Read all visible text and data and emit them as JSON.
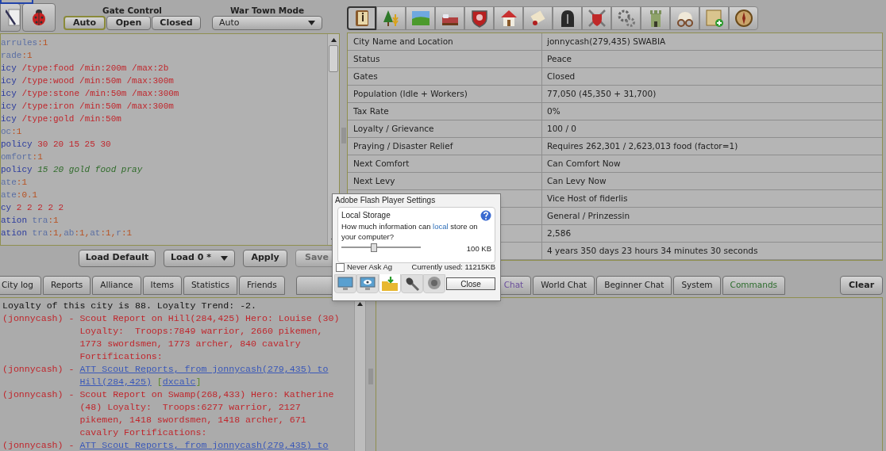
{
  "gate_control": {
    "label": "Gate Control",
    "options": [
      {
        "label": "Auto",
        "selected": true
      },
      {
        "label": "Open",
        "selected": false
      },
      {
        "label": "Closed",
        "selected": false
      }
    ]
  },
  "war_town_mode": {
    "label": "War Town Mode",
    "value": "Auto"
  },
  "toolbar": [
    {
      "selected": true
    },
    {
      "selected": false
    },
    {
      "selected": false
    },
    {
      "selected": false
    },
    {
      "selected": false
    },
    {
      "selected": false
    },
    {
      "selected": false
    },
    {
      "selected": false
    },
    {
      "selected": false
    },
    {
      "selected": false
    },
    {
      "selected": false
    },
    {
      "selected": false
    },
    {
      "selected": false
    },
    {
      "selected": false
    }
  ],
  "script_lines": [
    [
      {
        "kind": "attr",
        "text": "arrules"
      },
      {
        "kind": "val",
        "text": ":1"
      }
    ],
    [
      {
        "kind": "attr",
        "text": "rade"
      },
      {
        "kind": "val",
        "text": ":1"
      }
    ],
    [
      {
        "kind": "kw",
        "text": "icy"
      },
      {
        "kind": "arg",
        "text": " /type:food /min:200m /max:2b"
      }
    ],
    [
      {
        "kind": "kw",
        "text": "icy"
      },
      {
        "kind": "arg",
        "text": " /type:wood /min:50m /max:300m"
      }
    ],
    [
      {
        "kind": "kw",
        "text": "icy"
      },
      {
        "kind": "arg",
        "text": " /type:stone /min:50m /max:300m"
      }
    ],
    [
      {
        "kind": "kw",
        "text": "icy"
      },
      {
        "kind": "arg",
        "text": " /type:iron /min:50m /max:300m"
      }
    ],
    [
      {
        "kind": "kw",
        "text": "icy"
      },
      {
        "kind": "arg",
        "text": " /type:gold /min:50m"
      }
    ],
    [
      {
        "kind": "attr",
        "text": "oc"
      },
      {
        "kind": "val",
        "text": ":1"
      }
    ],
    [
      {
        "kind": "kw",
        "text": "policy"
      },
      {
        "kind": "arg",
        "text": " 30 20 15 25 30"
      }
    ],
    [
      {
        "kind": "attr",
        "text": "omfort"
      },
      {
        "kind": "val",
        "text": ":1"
      }
    ],
    [
      {
        "kind": "kw",
        "text": "policy"
      },
      {
        "kind": "comment",
        "text": " 15 20 gold food pray"
      }
    ],
    [
      {
        "kind": "attr",
        "text": "ate"
      },
      {
        "kind": "val",
        "text": ":1"
      }
    ],
    [
      {
        "kind": "attr",
        "text": "ate"
      },
      {
        "kind": "val",
        "text": ":0.1"
      }
    ],
    [
      {
        "kind": "kw",
        "text": "cy"
      },
      {
        "kind": "arg",
        "text": " 2 2 2 2 2"
      }
    ],
    [
      {
        "kind": "kw",
        "text": "ation"
      },
      {
        "kind": "attr",
        "text": " tra"
      },
      {
        "kind": "val",
        "text": ":1"
      }
    ],
    [
      {
        "kind": "kw",
        "text": "ation"
      },
      {
        "kind": "attr",
        "text": " tra"
      },
      {
        "kind": "val",
        "text": ":1,"
      },
      {
        "kind": "attr",
        "text": "ab"
      },
      {
        "kind": "val",
        "text": ":1,"
      },
      {
        "kind": "attr",
        "text": "at"
      },
      {
        "kind": "val",
        "text": ":1,"
      },
      {
        "kind": "attr",
        "text": "r"
      },
      {
        "kind": "val",
        "text": ":1"
      }
    ]
  ],
  "script_buttons": {
    "load_default": "Load Default",
    "load_slot": "Load 0 *",
    "apply": "Apply",
    "save": {
      "label": "Save",
      "disabled": true
    }
  },
  "city_info": [
    {
      "label": "City Name and Location",
      "value": "jonnycash(279,435) SWABIA"
    },
    {
      "label": "Status",
      "value": "Peace"
    },
    {
      "label": "Gates",
      "value": "Closed"
    },
    {
      "label": "Population (Idle + Workers)",
      "value": "77,050 (45,350 + 31,700)"
    },
    {
      "label": "Tax Rate",
      "value": "0%"
    },
    {
      "label": "Loyalty / Grievance",
      "value": "100 / 0"
    },
    {
      "label": "Praying / Disaster Relief",
      "value": "Requires 262,301 / 2,623,013 food (factor=1)"
    },
    {
      "label": "Next Comfort",
      "value": "Can Comfort Now"
    },
    {
      "label": "Next Levy",
      "value": "Can Levy Now"
    },
    {
      "value": "Vice Host of fiderlis"
    },
    {
      "value": "General / Prinzessin"
    },
    {
      "value": "2,586"
    },
    {
      "value": "4 years 350 days 23 hours 34 minutes 30 seconds"
    }
  ],
  "log_tabs": [
    "City log",
    "Reports",
    "Alliance",
    "Items",
    "Statistics",
    "Friends"
  ],
  "chat_tabs": [
    {
      "label": "Chat",
      "color": "#6b4f9c"
    },
    {
      "label": "World Chat",
      "color": "#222222"
    },
    {
      "label": "Beginner Chat",
      "color": "#222222"
    },
    {
      "label": "System",
      "color": "#222222"
    },
    {
      "label": "Commands",
      "color": "#2f6e2f"
    }
  ],
  "clear_button": "Clear",
  "log": [
    {
      "kind": "system",
      "text": "Loyalty of this city is 88. Loyalty Trend: -2."
    },
    {
      "kind": "report",
      "prefix": "(jonnycash) - ",
      "text": "Scout Report on Hill(284,425) Hero: Louise (30) Loyalty:  Troops:7849 warrior, 2660 pikemen, 1773 swordsmen, 1773 archer, 840 cavalry Fortifications:"
    },
    {
      "kind": "link",
      "prefix": "(jonnycash) - ",
      "link": "ATT Scout Reports, from jonnycash(279,435) to Hill(284,425)",
      "tag": {
        "open": "[",
        "label": "dxcalc",
        "close": "]"
      }
    },
    {
      "kind": "report",
      "prefix": "(jonnycash) - ",
      "text": "Scout Report on Swamp(268,433) Hero: Katherine (48) Loyalty:  Troops:6277 warrior, 2127 pikemen, 1418 swordsmen, 1418 archer, 671 cavalry Fortifications:"
    },
    {
      "kind": "link",
      "prefix": "(jonnycash) - ",
      "link": "ATT Scout Reports, from jonnycash(279,435) to"
    }
  ],
  "flash_dialog": {
    "title": "Adobe Flash Player Settings",
    "heading": "Local Storage",
    "question": [
      "How much information can ",
      "local",
      " store on your computer?"
    ],
    "level": 0.41,
    "reading": "100 KB",
    "never_ask": {
      "label": "Never Ask Ag",
      "checked": false
    },
    "usage": "Currently used: 11215KB",
    "tabs": [
      {
        "selected": false
      },
      {
        "selected": false
      },
      {
        "selected": true
      },
      {
        "selected": false
      },
      {
        "selected": false
      }
    ],
    "close": "Close"
  }
}
